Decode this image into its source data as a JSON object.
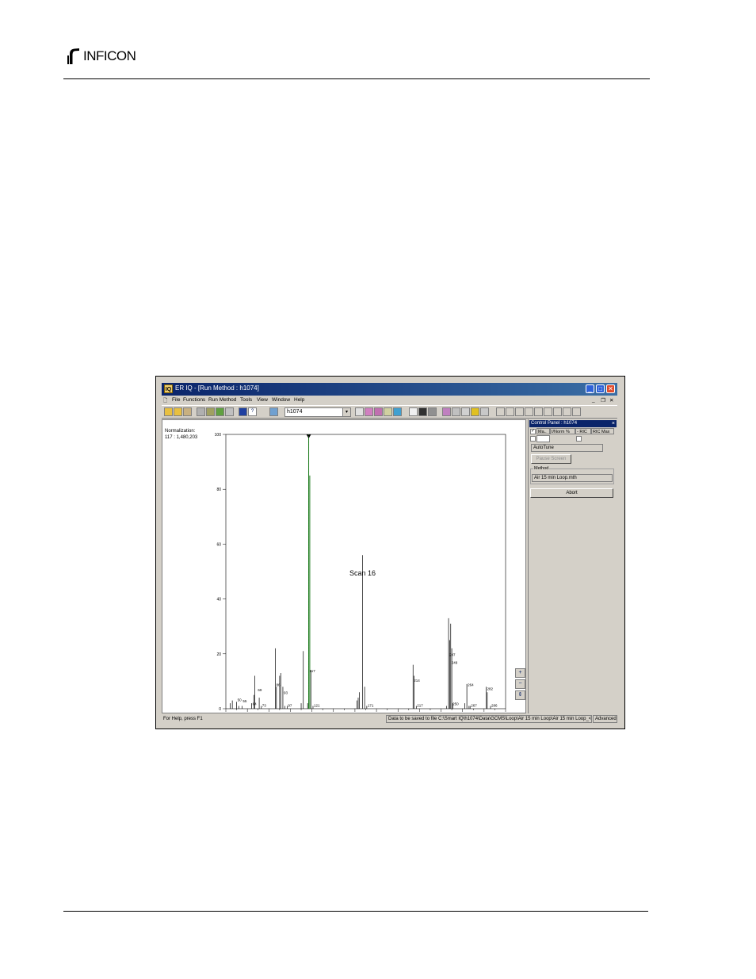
{
  "brand": {
    "name": "INFICON"
  },
  "window": {
    "app_icon": "IQ",
    "title": "ER IQ - [Run Method : h1074]",
    "controls": {
      "minimize": "_",
      "maximize": "□",
      "close": "✕"
    }
  },
  "menu": {
    "doc_icon": "🗋",
    "items": [
      "File",
      "Functions",
      "Run Method",
      "Tools",
      "View",
      "Window",
      "Help"
    ],
    "mdi_controls": {
      "minimize": "_",
      "restore": "❐",
      "close": "✕"
    }
  },
  "toolbar": {
    "combo_value": "h1074",
    "combo_arrow": "▾"
  },
  "chart": {
    "normalization_label": "Normalization:",
    "normalization_value": "117 : 1,480,203",
    "scan_label": "Scan 16"
  },
  "chart_data": {
    "type": "bar",
    "title": "",
    "xlabel": "",
    "ylabel": "",
    "xlim": [
      40,
      300
    ],
    "ylim": [
      0,
      100
    ],
    "x_ticks": [
      60,
      80,
      100,
      120,
      140,
      160,
      180,
      200,
      220,
      240,
      260,
      280,
      300
    ],
    "y_ticks": [
      0,
      20,
      40,
      60,
      80,
      100
    ],
    "peaks": [
      {
        "mz": 44,
        "value": 2
      },
      {
        "mz": 46,
        "value": 3
      },
      {
        "mz": 50,
        "value": 2.5
      },
      {
        "mz": 52,
        "value": 1
      },
      {
        "mz": 55,
        "value": 1
      },
      {
        "mz": 64,
        "value": 2
      },
      {
        "mz": 66,
        "value": 5
      },
      {
        "mz": 67,
        "value": 12
      },
      {
        "mz": 71,
        "value": 4
      },
      {
        "mz": 73,
        "value": 1
      },
      {
        "mz": 86,
        "value": 22
      },
      {
        "mz": 87,
        "value": 8
      },
      {
        "mz": 90,
        "value": 12
      },
      {
        "mz": 91,
        "value": 13
      },
      {
        "mz": 93,
        "value": 8
      },
      {
        "mz": 95,
        "value": 1
      },
      {
        "mz": 97,
        "value": 1
      },
      {
        "mz": 110,
        "value": 2
      },
      {
        "mz": 112,
        "value": 21
      },
      {
        "mz": 116,
        "value": 2
      },
      {
        "mz": 117,
        "value": 100
      },
      {
        "mz": 118,
        "value": 85
      },
      {
        "mz": 119,
        "value": 14
      },
      {
        "mz": 121,
        "value": 1
      },
      {
        "mz": 162,
        "value": 3
      },
      {
        "mz": 163,
        "value": 4
      },
      {
        "mz": 164,
        "value": 6
      },
      {
        "mz": 167,
        "value": 56
      },
      {
        "mz": 169,
        "value": 8
      },
      {
        "mz": 171,
        "value": 1
      },
      {
        "mz": 214,
        "value": 16
      },
      {
        "mz": 215,
        "value": 12
      },
      {
        "mz": 217,
        "value": 1
      },
      {
        "mz": 245,
        "value": 1
      },
      {
        "mz": 247,
        "value": 33
      },
      {
        "mz": 248,
        "value": 25
      },
      {
        "mz": 249,
        "value": 31
      },
      {
        "mz": 250,
        "value": 22
      },
      {
        "mz": 251,
        "value": 2
      },
      {
        "mz": 262,
        "value": 2
      },
      {
        "mz": 264,
        "value": 9
      },
      {
        "mz": 266,
        "value": 1
      },
      {
        "mz": 267,
        "value": 1
      },
      {
        "mz": 282,
        "value": 8
      },
      {
        "mz": 283,
        "value": 6
      },
      {
        "mz": 286,
        "value": 1
      }
    ],
    "peak_labels": [
      {
        "mz": 50,
        "text": "50",
        "value": 2.5
      },
      {
        "mz": 55,
        "text": "55",
        "value": 2
      },
      {
        "mz": 64,
        "text": "64",
        "value": 1
      },
      {
        "mz": 69,
        "text": "69",
        "value": 6
      },
      {
        "mz": 73,
        "text": "73",
        "value": 0.5
      },
      {
        "mz": 86,
        "text": "86",
        "value": 8
      },
      {
        "mz": 93,
        "text": "93",
        "value": 5
      },
      {
        "mz": 97,
        "text": "97",
        "value": 0.5
      },
      {
        "mz": 117,
        "text": "117",
        "value": 13
      },
      {
        "mz": 121,
        "text": "121",
        "value": 0.5
      },
      {
        "mz": 171,
        "text": "171",
        "value": 0.5
      },
      {
        "mz": 214,
        "text": "214",
        "value": 9.5
      },
      {
        "mz": 217,
        "text": "217",
        "value": 0.5
      },
      {
        "mz": 247,
        "text": "247",
        "value": 19
      },
      {
        "mz": 249,
        "text": "249",
        "value": 16
      },
      {
        "mz": 250,
        "text": "250",
        "value": 1
      },
      {
        "mz": 264,
        "text": "264",
        "value": 8
      },
      {
        "mz": 267,
        "text": "267",
        "value": 0.5
      },
      {
        "mz": 282,
        "text": "282",
        "value": 6.5
      },
      {
        "mz": 286,
        "text": "286",
        "value": 0.5
      }
    ],
    "highlight_mz": 117,
    "colors": {
      "peaks": "#000000",
      "highlight": "#1a7a1a",
      "axis": "#000000"
    }
  },
  "zoom_controls": {
    "zoom_in": "+",
    "zoom_out": "−",
    "fit": "⇕"
  },
  "control_panel": {
    "title": "Control Panel : h1074",
    "close": "×",
    "columns": [
      "Ma..",
      "I/Norm %",
      "- RIC",
      "RIC Max"
    ],
    "check_mark": "✓",
    "autotune_value": "AutoTune",
    "pause_button": "Pause Screen",
    "method_label": "Method",
    "method_value": "Air 15 min Loop.mth",
    "abort_button": "Abort"
  },
  "status": {
    "help_text": "For Help, press F1",
    "save_text": "Data to be saved to file C:\\Smart IQ\\h1074\\Data\\GCMS\\Loop\\Air 15 min Loop\\Air 15 min Loop_<",
    "mode": "Advanced"
  }
}
